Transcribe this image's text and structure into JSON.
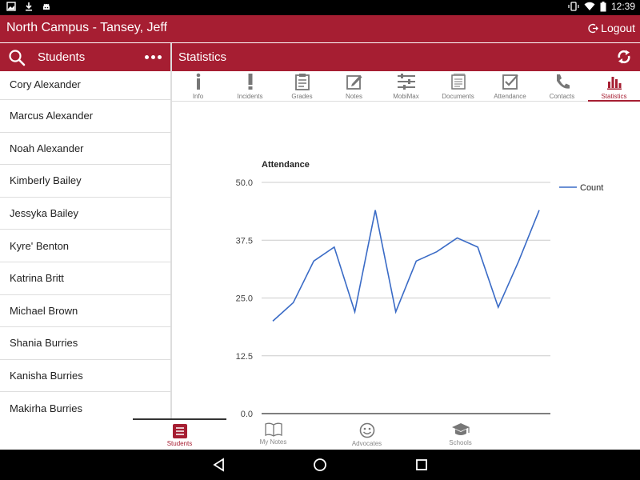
{
  "statusbar": {
    "time": "12:39"
  },
  "appbar": {
    "title": "North Campus - Tansey, Jeff",
    "logout_label": "Logout"
  },
  "sidebar": {
    "title": "Students",
    "students": [
      "Cory Alexander",
      "Marcus Alexander",
      "Noah Alexander",
      "Kimberly Bailey",
      "Jessyka Bailey",
      "Kyre' Benton",
      "Katrina Britt",
      "Michael Brown",
      "Shania Burries",
      "Kanisha Burries",
      "Makirha Burries"
    ]
  },
  "main": {
    "title": "Statistics",
    "tabs": [
      {
        "label": "Info",
        "icon": "info-icon"
      },
      {
        "label": "Incidents",
        "icon": "exclamation-icon"
      },
      {
        "label": "Grades",
        "icon": "clipboard-icon"
      },
      {
        "label": "Notes",
        "icon": "pencil-note-icon"
      },
      {
        "label": "MobiMax",
        "icon": "sliders-icon"
      },
      {
        "label": "Documents",
        "icon": "documents-icon"
      },
      {
        "label": "Attendance",
        "icon": "checkbox-icon"
      },
      {
        "label": "Contacts",
        "icon": "phone-icon"
      },
      {
        "label": "Statistics",
        "icon": "bar-chart-icon",
        "active": true
      }
    ]
  },
  "chart_data": {
    "type": "line",
    "title": "Attendance",
    "ylim": [
      0,
      50
    ],
    "yticks": [
      "0.0",
      "12.5",
      "25.0",
      "37.5",
      "50.0"
    ],
    "ytick_values": [
      0,
      12.5,
      25,
      37.5,
      50
    ],
    "grid": true,
    "legend_position": "top-right",
    "series": [
      {
        "name": "Count",
        "color": "#3a6bc6",
        "values": [
          20,
          24,
          33,
          36,
          22,
          44,
          22,
          33,
          35,
          38,
          36,
          23,
          33,
          44
        ]
      }
    ]
  },
  "bottomnav": {
    "items": [
      {
        "label": "Students",
        "icon": "list-icon",
        "active": true
      },
      {
        "label": "My Notes",
        "icon": "book-icon"
      },
      {
        "label": "Advocates",
        "icon": "smiley-icon"
      },
      {
        "label": "Schools",
        "icon": "graduation-cap-icon"
      }
    ]
  },
  "colors": {
    "brand": "#a61e32",
    "line": "#3a6bc6"
  }
}
